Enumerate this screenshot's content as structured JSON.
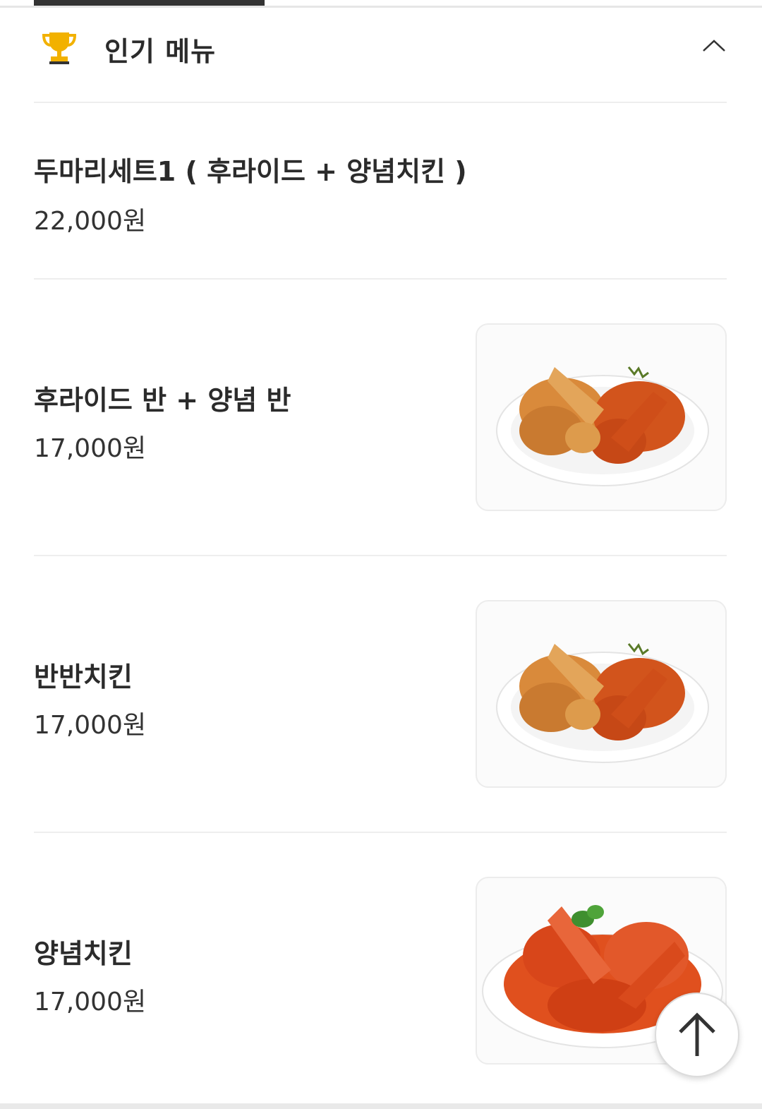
{
  "section": {
    "title": "인기 메뉴",
    "icon": "trophy-icon",
    "collapse_icon": "chevron-up-icon",
    "accent_color": "#f2b100"
  },
  "items": [
    {
      "name": "두마리세트1 ( 후라이드 + 양념치킨 )",
      "price": "22,000원",
      "has_image": false
    },
    {
      "name": "후라이드 반 + 양념 반",
      "price": "17,000원",
      "has_image": true
    },
    {
      "name": "반반치킨",
      "price": "17,000원",
      "has_image": true
    },
    {
      "name": "양념치킨",
      "price": "17,000원",
      "has_image": true
    }
  ],
  "scroll_top": {
    "icon": "arrow-up-icon"
  }
}
